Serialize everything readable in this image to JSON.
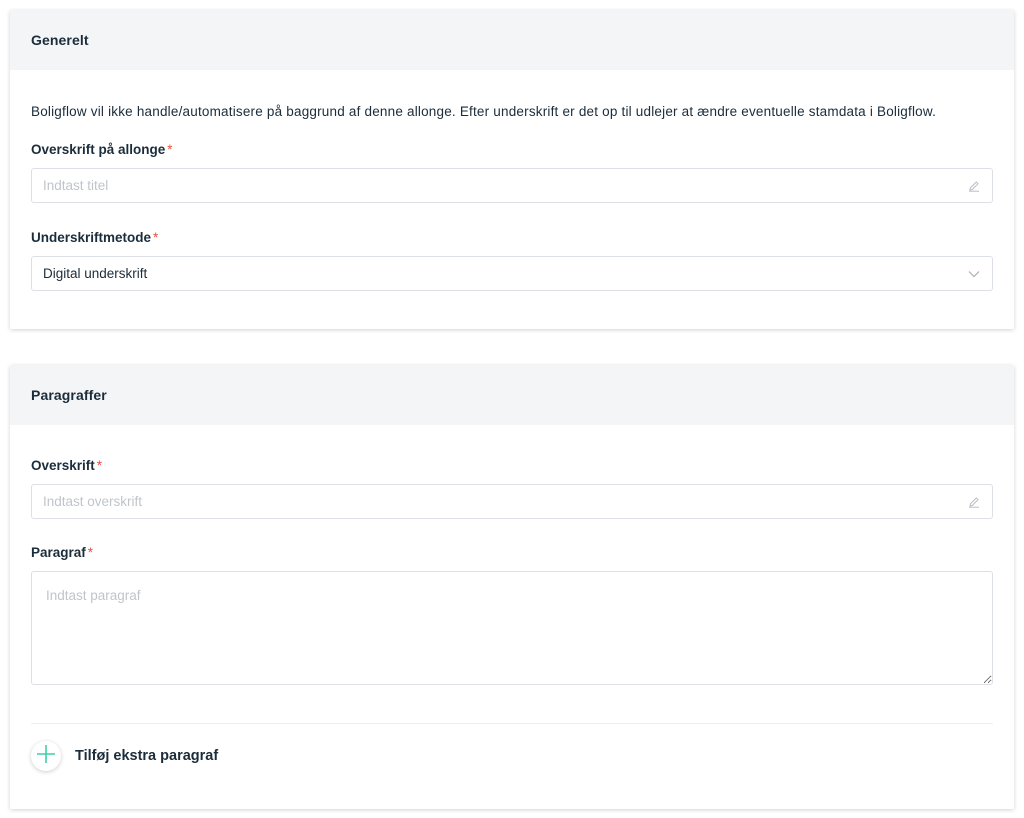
{
  "general": {
    "title": "Generelt",
    "info_text": "Boligflow vil ikke handle/automatisere på baggrund af denne allonge. Efter underskrift er det op til udlejer at ændre eventuelle stamdata i Boligflow.",
    "heading_field": {
      "label": "Overskrift på allonge",
      "required_mark": "*",
      "placeholder": "Indtast titel",
      "value": "",
      "icon": "pencil-icon"
    },
    "signature_method": {
      "label": "Underskriftmetode",
      "required_mark": "*",
      "selected": "Digital underskrift",
      "icon": "chevron-down-icon"
    }
  },
  "paragraphs": {
    "title": "Paragraffer",
    "heading_field": {
      "label": "Overskrift",
      "required_mark": "*",
      "placeholder": "Indtast overskrift",
      "value": "",
      "icon": "pencil-icon"
    },
    "paragraph_field": {
      "label": "Paragraf",
      "required_mark": "*",
      "placeholder": "Indtast paragraf",
      "value": ""
    },
    "add_button": {
      "label": "Tilføj ekstra paragraf",
      "icon": "plus-icon",
      "icon_color": "#3ecfa5"
    }
  },
  "colors": {
    "required": "#e8513c",
    "header_bg": "#f4f5f6",
    "text": "#1b2c3a",
    "accent": "#3ecfa5"
  }
}
